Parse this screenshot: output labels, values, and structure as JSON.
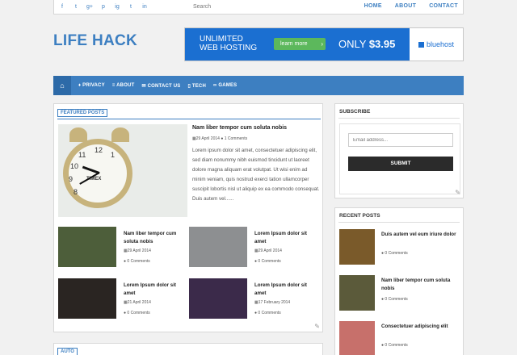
{
  "topbar": {
    "social": [
      "f",
      "t",
      "g+",
      "p",
      "ig",
      "t",
      "in"
    ],
    "search_placeholder": "Search",
    "nav": [
      "HOME",
      "ABOUT",
      "CONTACT"
    ]
  },
  "logo": "LIFE HACK",
  "banner": {
    "line1": "UNLIMITED",
    "line2": "WEB HOSTING",
    "button": "learn more",
    "only": "ONLY",
    "price": "$3.95",
    "brand": "bluehost"
  },
  "nav": [
    "PRIVACY",
    "ABOUT",
    "CONTACT US",
    "TECH",
    "GAMES"
  ],
  "featured": {
    "label": "FEATURED POSTS",
    "main": {
      "title": "Nam liber tempor cum soluta nobis",
      "date": "29 April 2014",
      "comments": "1 Comments",
      "excerpt": "Lorem ipsum dolor sit amet, consectetuer adipiscing elit, sed diam nonummy nibh euismod tincidunt ut laoreet dolore magna aliquam erat volutpat. Ut wisi enim ad minim veniam, quis nostrud exerci tation ullamcorper suscipit lobortis nisl ut aliquip ex ea commodo consequat. Duis autem vel......",
      "clock_brand": "TIMEX",
      "clock_numbers": [
        "12",
        "1",
        "11",
        "10",
        "9",
        "8"
      ]
    },
    "posts": [
      {
        "title": "Nam liber tempor cum soluta nobis",
        "date": "29 April 2014",
        "comments": "0 Comments",
        "thumb": "#4d5e3a"
      },
      {
        "title": "Lorem Ipsum dolor sit amet",
        "date": "29 April 2014",
        "comments": "0 Comments",
        "thumb": "#8d8f91"
      },
      {
        "title": "Lorem Ipsum dolor sit amet",
        "date": "21 April 2014",
        "comments": "0 Comments",
        "thumb": "#2a2522"
      },
      {
        "title": "Lorem Ipsum dolor sit amet",
        "date": "17 February 2014",
        "comments": "0 Comments",
        "thumb": "#3b2a4a"
      }
    ]
  },
  "next_label": "AUTO",
  "subscribe": {
    "heading": "SUBSCRIBE",
    "placeholder": "Email address...",
    "button": "SUBMIT"
  },
  "recent": {
    "heading": "RECENT POSTS",
    "items": [
      {
        "title": "Duis autem vel eum iriure dolor",
        "comments": "0 Comments",
        "thumb": "#7a5a2a"
      },
      {
        "title": "Nam liber tempor cum soluta nobis",
        "comments": "0 Comments",
        "thumb": "#5b5a3a"
      },
      {
        "title": "Consectetuer adipiscing elit",
        "comments": "0 Comments",
        "thumb": "#c7706b"
      }
    ]
  },
  "colors": {
    "accent": "#3d7fc1",
    "banner": "#1b6fd1",
    "button": "#5cb85c"
  }
}
